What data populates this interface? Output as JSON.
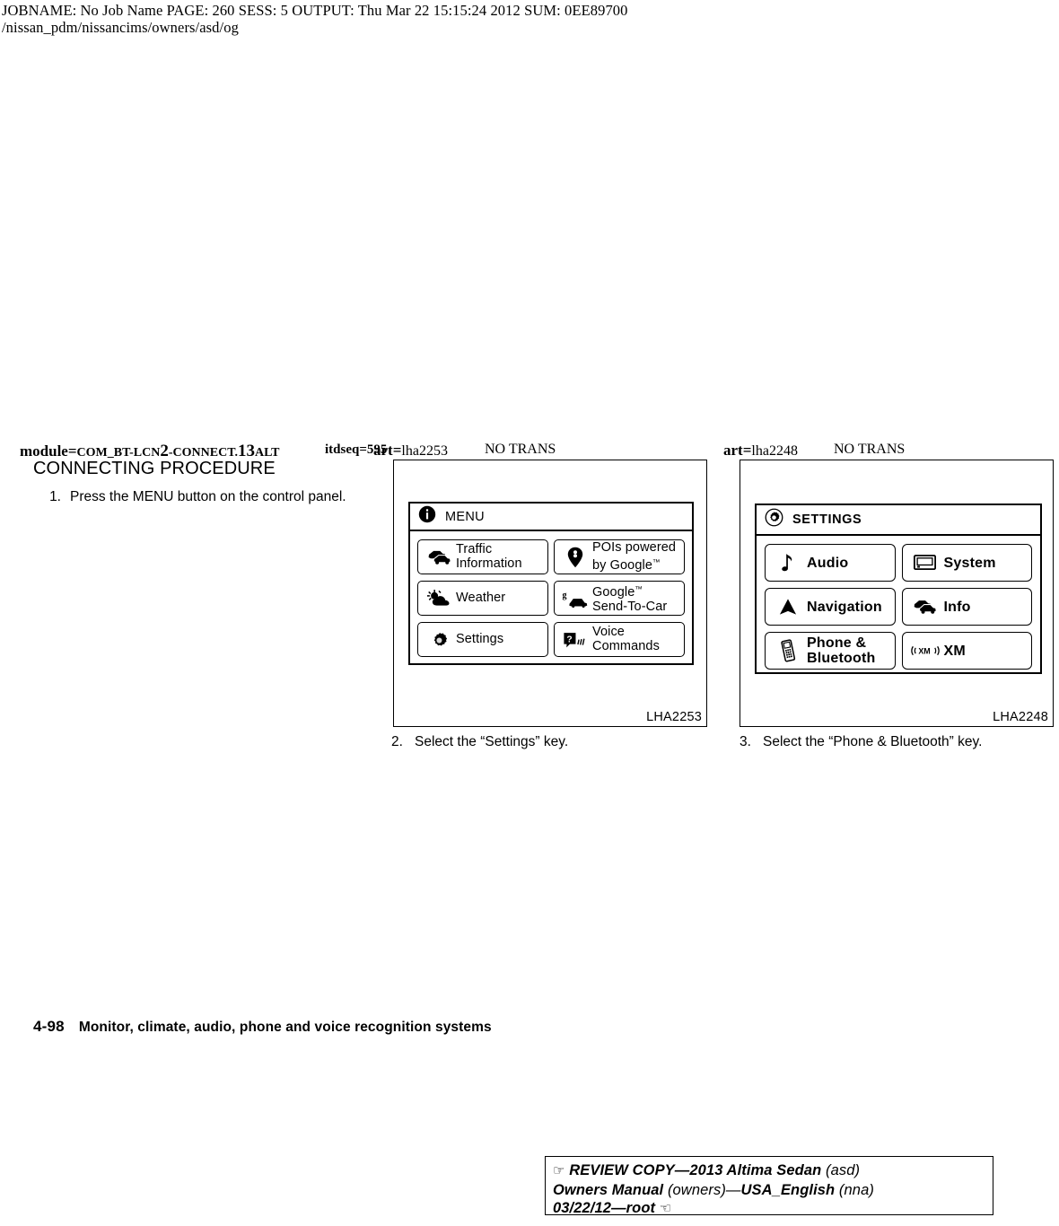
{
  "job_header": {
    "line1": "JOBNAME: No Job Name   PAGE: 260   SESS: 5   OUTPUT: Thu Mar 22 15:15:24 2012   SUM: 0EE89700",
    "line2": "/nissan_pdm/nissancims/owners/asd/og"
  },
  "markers": {
    "module_prefix": "module=",
    "module_sc1": "COM_BT-LCN",
    "module_num1": "2",
    "module_sc2": "-CONNECT.",
    "module_num2": "13",
    "module_sc3": "ALT",
    "itdseq": "itdseq=595",
    "art_left_key": "art=",
    "art_left_value": "lha2253",
    "no_trans_left": "NO TRANS",
    "art_right_key": "art=",
    "art_right_value": "lha2248",
    "no_trans_right": "NO TRANS"
  },
  "section": {
    "title": "CONNECTING PROCEDURE",
    "step1_number": "1.",
    "step1_text_line1": "Press   the   MENU   button   on   the   control",
    "step1_text_line2": "panel."
  },
  "figure_left": {
    "id": "LHA2253",
    "screen": {
      "title": "MENU",
      "title_icon": "info-icon",
      "keys": [
        {
          "icon": "traffic-cars-icon",
          "line1": "Traffic",
          "line2": "Information"
        },
        {
          "icon": "map-pin-icon",
          "line1": "POIs powered",
          "line2": "by Google",
          "tm": "™"
        },
        {
          "icon": "weather-cloud-sun-icon",
          "line1": "Weather",
          "line2": ""
        },
        {
          "icon": "send-to-car-icon",
          "line1": "Google",
          "tm": "™",
          "line2": "Send-To-Car"
        },
        {
          "icon": "gear-icon",
          "line1": "Settings",
          "line2": ""
        },
        {
          "icon": "voice-commands-icon",
          "line1": "Voice",
          "line2": "Commands"
        }
      ]
    },
    "caption_number": "2.",
    "caption_text": "Select the “Settings” key."
  },
  "figure_right": {
    "id": "LHA2248",
    "screen": {
      "title": "SETTINGS",
      "title_icon": "gear-circle-icon",
      "keys": [
        {
          "icon": "music-note-icon",
          "line1": "Audio",
          "line2": ""
        },
        {
          "icon": "display-monitor-icon",
          "line1": "System",
          "line2": ""
        },
        {
          "icon": "navigation-arrow-icon",
          "line1": "Navigation",
          "line2": ""
        },
        {
          "icon": "car-info-icon",
          "line1": "Info",
          "line2": ""
        },
        {
          "icon": "cellphone-icon",
          "line1": "Phone &",
          "line2": "Bluetooth"
        },
        {
          "icon": "xm-radio-icon",
          "line1": "XM",
          "line2": ""
        }
      ]
    },
    "caption_number": "3.",
    "caption_text": "Select the “Phone & Bluetooth” key."
  },
  "footer": {
    "page_number": "4-98",
    "title": "Monitor, climate, audio, phone and voice recognition systems"
  },
  "review_box": {
    "hand_icon": "pointing-hand-icon",
    "line1_bold": "REVIEW COPY—2013 Altima Sedan",
    "line1_reg": "(asd)",
    "line2_bold_a": "Owners Manual",
    "line2_reg_a": "(owners)—",
    "line2_bold_b": "USA_English",
    "line2_reg_b": "(nna)",
    "line3_bold": "03/22/12—root",
    "line3_icon": "hand-back-icon"
  }
}
